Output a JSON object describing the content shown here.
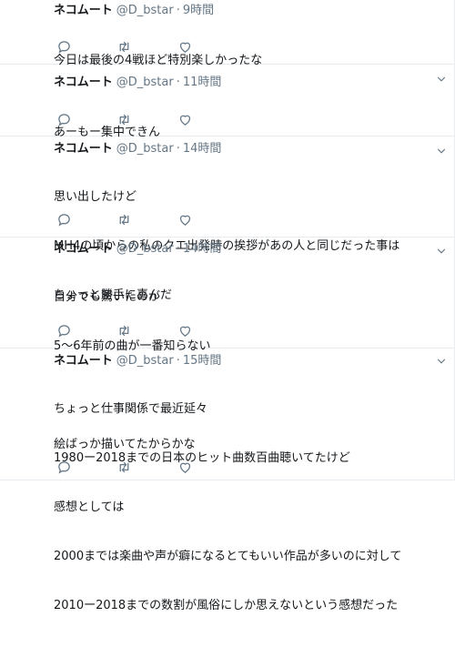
{
  "tweets": [
    {
      "name": "ネコムート",
      "handle": "@D_bstar",
      "sep": "·",
      "time": "9時間",
      "lines": [
        "今日は最後の4戦ほど特別楽しかったな"
      ]
    },
    {
      "name": "ネコムート",
      "handle": "@D_bstar",
      "sep": "·",
      "time": "11時間",
      "lines": [
        "あーもー集中できん"
      ]
    },
    {
      "name": "ネコムート",
      "handle": "@D_bstar",
      "sep": "·",
      "time": "14時間",
      "lines": [
        "思い出したけど",
        "MH4の頃からの私のクエ出発時の挨拶があの人と同じだった事は",
        "ちょっと勝手に喜んだ"
      ]
    },
    {
      "name": "ネコムート",
      "handle": "@D_bstar",
      "sep": "·",
      "time": "14時間",
      "lines": [
        "自分でも驚いたのが",
        "5〜6年前の曲が一番知らない",
        "",
        "絵ばっか描いてたからかな"
      ]
    },
    {
      "name": "ネコムート",
      "handle": "@D_bstar",
      "sep": "·",
      "time": "15時間",
      "lines": [
        "ちょっと仕事関係で最近延々",
        "1980ー2018までの日本のヒット曲数百曲聴いてたけど",
        "感想としては",
        "2000までは楽曲や声が癖になるとてもいい作品が多いのに対して",
        "2010ー2018までの数割が風俗にしか思えないという感想だった"
      ]
    }
  ],
  "icons": {
    "reply": "reply-icon",
    "retweet": "retweet-icon",
    "like": "like-icon",
    "more": "chevron-down-icon"
  },
  "colors": {
    "text": "#14171a",
    "secondary": "#657786",
    "divider": "#e6ecf0"
  }
}
